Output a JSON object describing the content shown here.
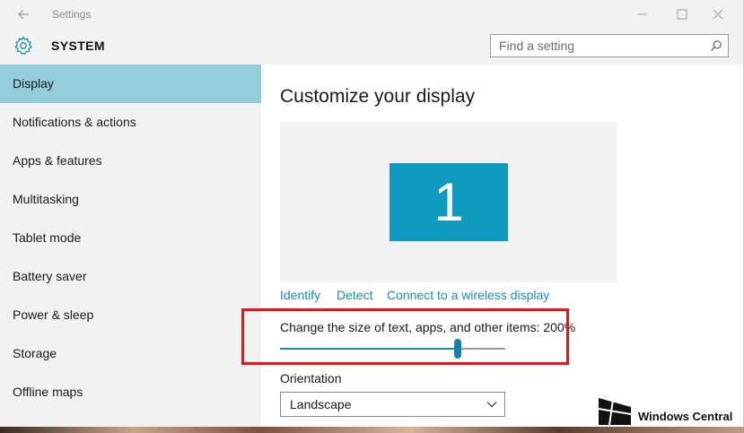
{
  "window": {
    "title": "Settings"
  },
  "header": {
    "section_title": "SYSTEM",
    "search_placeholder": "Find a setting"
  },
  "sidebar": {
    "items": [
      {
        "label": "Display",
        "selected": true
      },
      {
        "label": "Notifications & actions",
        "selected": false
      },
      {
        "label": "Apps & features",
        "selected": false
      },
      {
        "label": "Multitasking",
        "selected": false
      },
      {
        "label": "Tablet mode",
        "selected": false
      },
      {
        "label": "Battery saver",
        "selected": false
      },
      {
        "label": "Power & sleep",
        "selected": false
      },
      {
        "label": "Storage",
        "selected": false
      },
      {
        "label": "Offline maps",
        "selected": false
      }
    ]
  },
  "main": {
    "title": "Customize your display",
    "monitor_number": "1",
    "links": {
      "identify": "Identify",
      "detect": "Detect",
      "wireless": "Connect to a wireless display"
    },
    "scale": {
      "label": "Change the size of text, apps, and other items: 200%",
      "slider_fraction": 0.79
    },
    "orientation": {
      "label": "Orientation",
      "selected": "Landscape"
    }
  },
  "watermark": {
    "text": "Windows Central"
  },
  "colors": {
    "accent": "#1a8fb3",
    "selected_nav": "#92cdd9",
    "monitor_tile": "#0e9bbf",
    "highlight": "#e8141b"
  }
}
